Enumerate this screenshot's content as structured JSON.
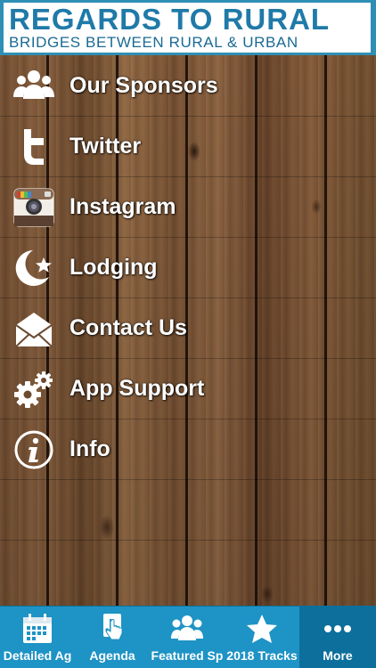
{
  "header": {
    "title": "REGARDS TO RURAL",
    "subtitle": "BRIDGES BETWEEN RURAL & URBAN"
  },
  "menu": {
    "items": [
      {
        "label": "Our Sponsors",
        "icon": "people-icon"
      },
      {
        "label": "Twitter",
        "icon": "twitter-icon"
      },
      {
        "label": "Instagram",
        "icon": "instagram-icon"
      },
      {
        "label": "Lodging",
        "icon": "moon-star-icon"
      },
      {
        "label": "Contact Us",
        "icon": "envelope-icon"
      },
      {
        "label": "App Support",
        "icon": "gears-icon"
      },
      {
        "label": "Info",
        "icon": "info-icon"
      }
    ]
  },
  "tabbar": {
    "tabs": [
      {
        "label": "Detailed Ag",
        "icon": "calendar-icon"
      },
      {
        "label": "Agenda",
        "icon": "touch-icon"
      },
      {
        "label": "Featured Sp",
        "icon": "people-icon"
      },
      {
        "label": "2018 Tracks",
        "icon": "star-icon"
      },
      {
        "label": "More",
        "icon": "more-icon",
        "active": true
      }
    ]
  },
  "colors": {
    "brand_blue": "#1f7aa8",
    "tabbar_bg": "#1e93c5",
    "tabbar_active": "#0d6f9c",
    "menu_text": "#ffffff"
  }
}
